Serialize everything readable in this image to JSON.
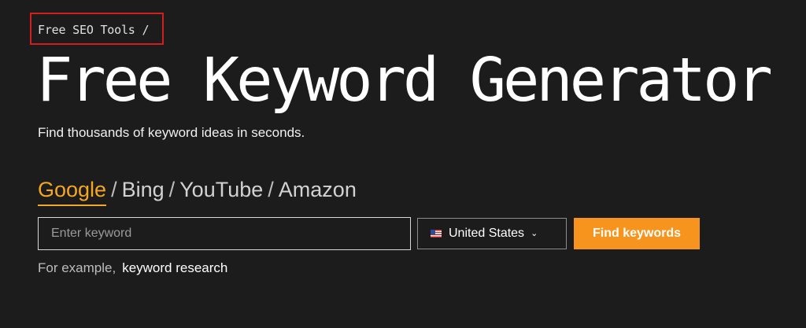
{
  "breadcrumb": {
    "text": "Free SEO Tools /",
    "highlight_color": "#d41e1e"
  },
  "page": {
    "title": "Free Keyword Generator",
    "subtitle": "Find thousands of keyword ideas in seconds."
  },
  "engines": {
    "items": [
      "Google",
      "Bing",
      "YouTube",
      "Amazon"
    ],
    "selected": "Google",
    "separator": "/"
  },
  "search": {
    "placeholder": "Enter keyword",
    "value": ""
  },
  "country": {
    "flag_icon": "us-flag-icon",
    "selected": "United States",
    "chevron_icon": "chevron-down-icon",
    "chevron_glyph": "⌄"
  },
  "actions": {
    "find_label": "Find keywords"
  },
  "example": {
    "label": "For example,",
    "keyword": "keyword research"
  },
  "colors": {
    "background": "#1c1c1c",
    "accent": "#f5a623",
    "button": "#f7941d"
  }
}
